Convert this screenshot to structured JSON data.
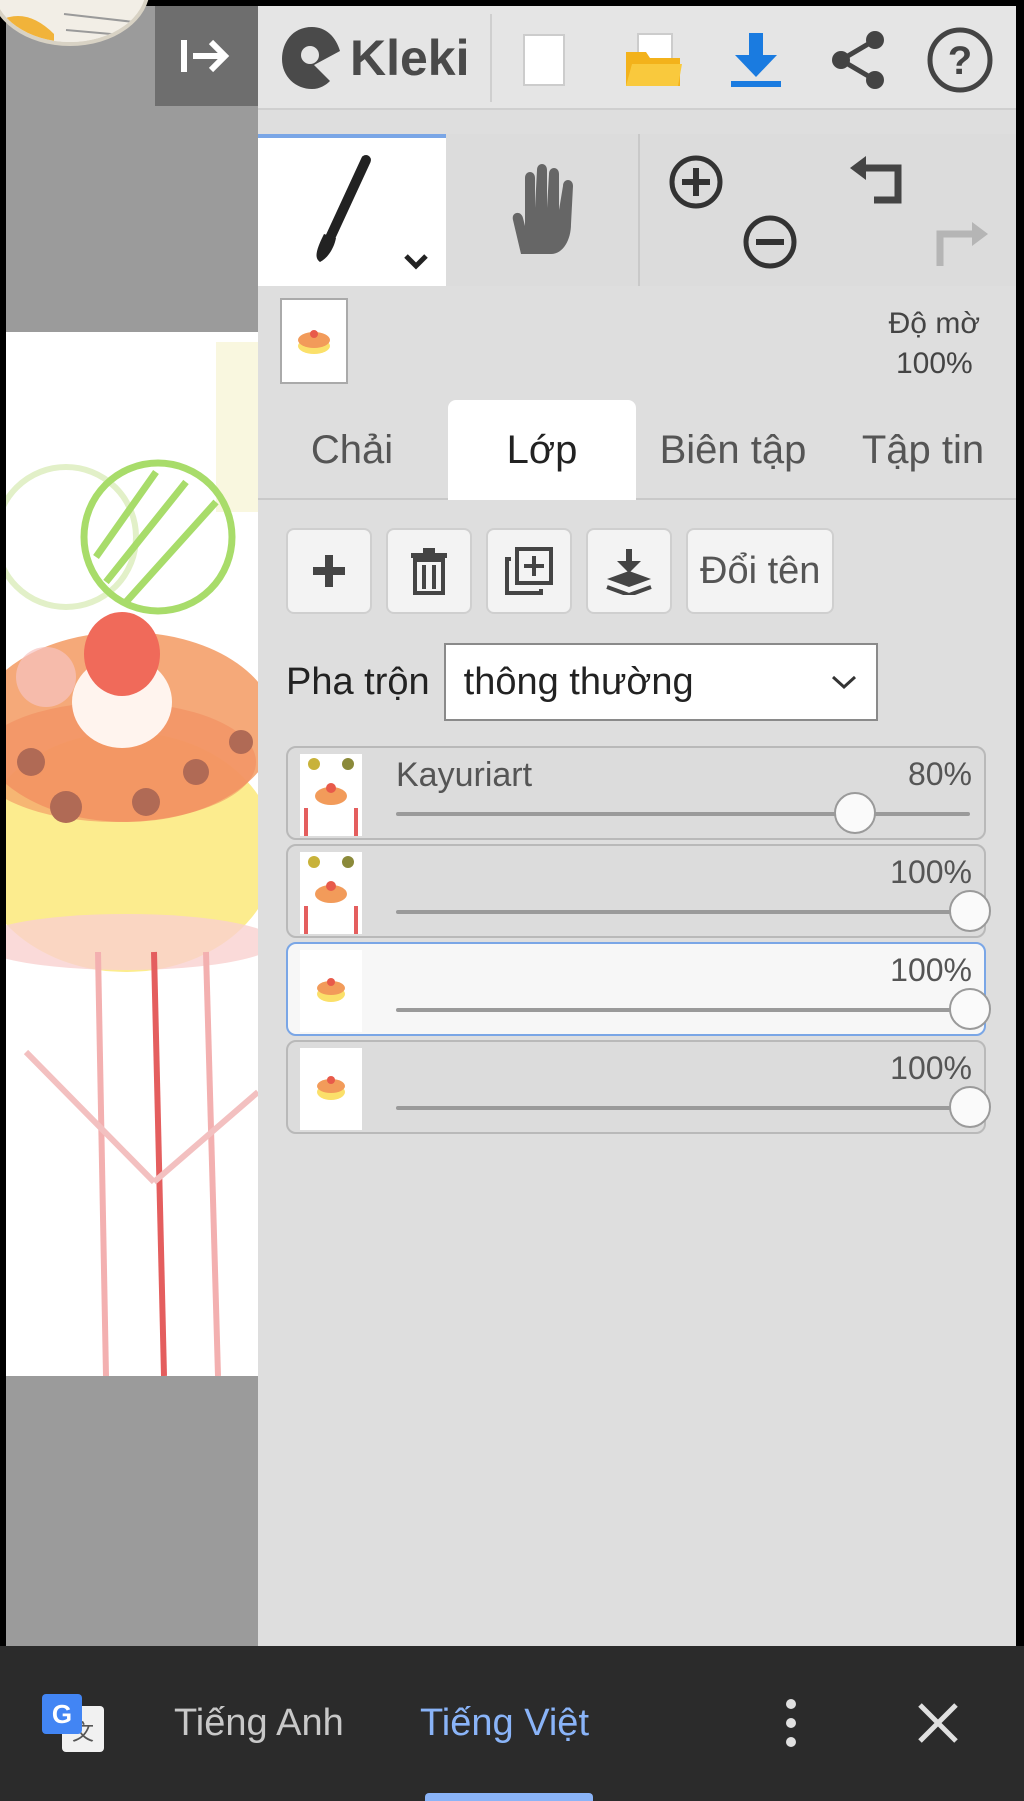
{
  "app": {
    "name": "Kleki"
  },
  "toolbar": {
    "new_icon": "new-file-icon",
    "open_icon": "folder-open-icon",
    "save_icon": "download-icon",
    "share_icon": "share-icon",
    "help_icon": "help-icon"
  },
  "opacity": {
    "label": "Độ mờ",
    "value": "100%"
  },
  "tabs": [
    {
      "label": "Chải",
      "active": false
    },
    {
      "label": "Lớp",
      "active": true
    },
    {
      "label": "Biên tập",
      "active": false
    },
    {
      "label": "Tập tin",
      "active": false
    }
  ],
  "layer_tools": {
    "rename_label": "Đổi tên"
  },
  "blend": {
    "label": "Pha trộn",
    "value": "thông thường"
  },
  "layers": [
    {
      "name": "Kayuriart",
      "opacity_label": "80%",
      "opacity": 0.8,
      "selected": false
    },
    {
      "name": "",
      "opacity_label": "100%",
      "opacity": 1.0,
      "selected": false
    },
    {
      "name": "",
      "opacity_label": "100%",
      "opacity": 1.0,
      "selected": true
    },
    {
      "name": "",
      "opacity_label": "100%",
      "opacity": 1.0,
      "selected": false
    }
  ],
  "translate_bar": {
    "source_lang": "Tiếng Anh",
    "target_lang": "Tiếng Việt",
    "accent": "#8ab4f8"
  },
  "colors": {
    "accent": "#1a7be0",
    "selection": "#7aa6e6"
  }
}
